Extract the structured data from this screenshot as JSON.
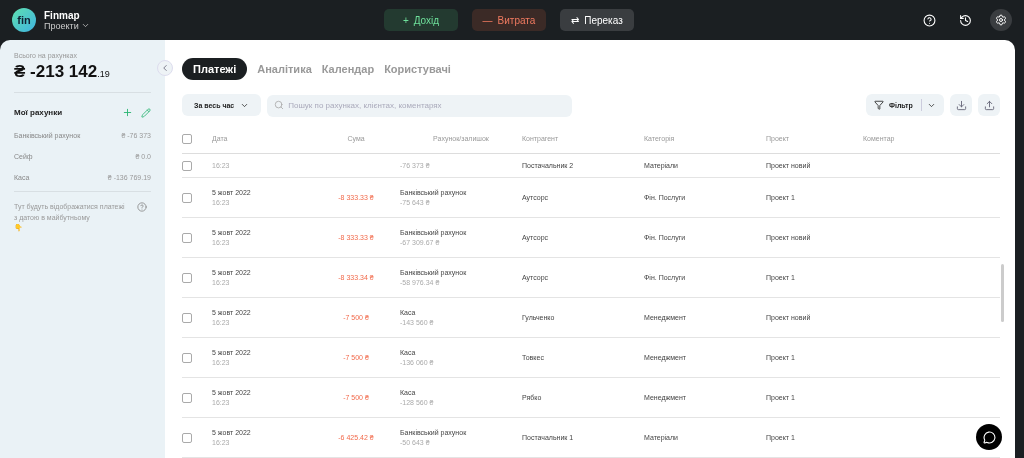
{
  "app": {
    "logo": "fin",
    "name": "Finmap",
    "project_menu": "Проекти"
  },
  "actions": [
    {
      "kind": "income",
      "icon": "+",
      "label": "Дохід"
    },
    {
      "kind": "expense",
      "icon": "—",
      "label": "Витрата"
    },
    {
      "kind": "transfer",
      "icon": "⇄",
      "label": "Переказ"
    }
  ],
  "sidebar": {
    "total_label": "Всього на рахунках",
    "total_currency": "₴",
    "total_main": "-213 142",
    "total_cents": ".19",
    "accounts_title": "Мої рахунки",
    "accounts": [
      {
        "name": "Банківський рахунок",
        "currency": "₴",
        "amount": "-76 373"
      },
      {
        "name": "Сейф",
        "currency": "₴",
        "amount": "0",
        "cents": ".0"
      },
      {
        "name": "Каса",
        "currency": "₴",
        "amount": "-136 769",
        "cents": ".19"
      }
    ],
    "future_note": "Тут будуть відображатися платежі з датою в майбутньому",
    "future_emoji": "👇"
  },
  "tabs": [
    {
      "label": "Платежі",
      "selected": true
    },
    {
      "label": "Аналітика",
      "selected": false
    },
    {
      "label": "Календар",
      "selected": false
    },
    {
      "label": "Користувачі",
      "selected": false
    }
  ],
  "period": "За весь час",
  "search": {
    "placeholder": "Пошук по рахунках, клієнтах, коментарях"
  },
  "filter": "Фільтр",
  "table": {
    "select_all_checked": false,
    "columns": [
      "Дата",
      "Сума",
      "Рахунок/залишок",
      "Контрагент",
      "Категорія",
      "Проект",
      "Коментар"
    ],
    "rows": [
      {
        "kind": "partial",
        "checked": false,
        "time": "16:23",
        "balance": "-76 373 ₴",
        "counterparty": "Постачальник 2",
        "category": "Матеріали",
        "project": "Проект новий"
      },
      {
        "kind": "full",
        "checked": false,
        "date": "5 жовт 2022",
        "time": "16:23",
        "amount": "-8 333.33 ₴",
        "account": "Банківський рахунок",
        "balance": "-75 643 ₴",
        "counterparty": "Аутсорс",
        "category": "Фін. Послуги",
        "project": "Проект 1"
      },
      {
        "kind": "full",
        "checked": false,
        "date": "5 жовт 2022",
        "time": "16:23",
        "amount": "-8 333.33 ₴",
        "account": "Банківський рахунок",
        "balance": "-67 309.67 ₴",
        "counterparty": "Аутсорс",
        "category": "Фін. Послуги",
        "project": "Проект новий"
      },
      {
        "kind": "full",
        "checked": false,
        "date": "5 жовт 2022",
        "time": "16:23",
        "amount": "-8 333.34 ₴",
        "account": "Банківський рахунок",
        "balance": "-58 976.34 ₴",
        "counterparty": "Аутсорс",
        "category": "Фін. Послуги",
        "project": "Проект 1"
      },
      {
        "kind": "full",
        "checked": false,
        "date": "5 жовт 2022",
        "time": "16:23",
        "amount": "-7 500 ₴",
        "account": "Каса",
        "balance": "-143 560 ₴",
        "counterparty": "Гульченко",
        "category": "Менеджмент",
        "project": "Проект новий"
      },
      {
        "kind": "full",
        "checked": false,
        "date": "5 жовт 2022",
        "time": "16:23",
        "amount": "-7 500 ₴",
        "account": "Каса",
        "balance": "-136 060 ₴",
        "counterparty": "Товкес",
        "category": "Менеджмент",
        "project": "Проект 1"
      },
      {
        "kind": "full",
        "checked": false,
        "date": "5 жовт 2022",
        "time": "16:23",
        "amount": "-7 500 ₴",
        "account": "Каса",
        "balance": "-128 560 ₴",
        "counterparty": "Рябко",
        "category": "Менеджмент",
        "project": "Проект 1"
      },
      {
        "kind": "full",
        "checked": false,
        "date": "5 жовт 2022",
        "time": "16:23",
        "amount": "-6 425.42 ₴",
        "account": "Банківський рахунок",
        "balance": "-50 643 ₴",
        "counterparty": "Постачальник 1",
        "category": "Матеріали",
        "project": "Проект 1"
      }
    ]
  }
}
